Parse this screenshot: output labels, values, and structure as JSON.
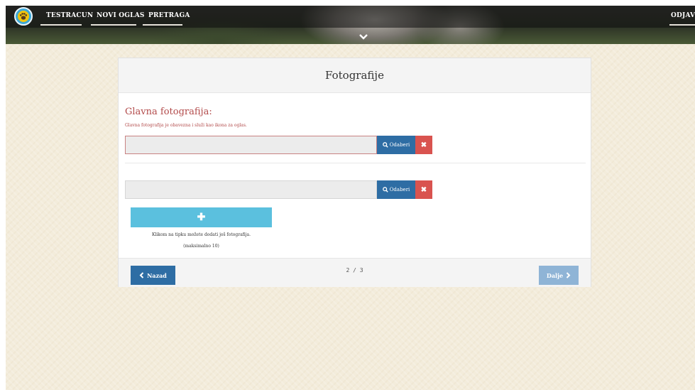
{
  "nav": {
    "items": [
      "TESTRACUN",
      "NOVI OGLAS",
      "PRETRAGA"
    ],
    "logout": "ODJAV"
  },
  "card": {
    "title": "Fotografije",
    "main_photo": {
      "title": "Glavna fotografija:",
      "hint": "Glavna fotografija je obavezna i služi kao ikona za oglas."
    },
    "select_label": "Odaberi",
    "add_hint_line1": "Klikom na tipku možete dodati još fotografija.",
    "add_hint_line2": "(maksimalno 10)",
    "back_label": "Nazad",
    "next_label": "Dalje",
    "page": "2 / 3"
  },
  "colors": {
    "primary": "#2e6da4",
    "danger": "#d9534f",
    "info": "#5bc0de",
    "error_text": "#b24a4a",
    "disabled_primary": "#8fb4d6"
  },
  "icons": [
    "paw-logo-icon",
    "chevron-down-icon",
    "search-icon",
    "close-icon",
    "plus-icon",
    "chevron-left-icon",
    "chevron-right-icon"
  ]
}
